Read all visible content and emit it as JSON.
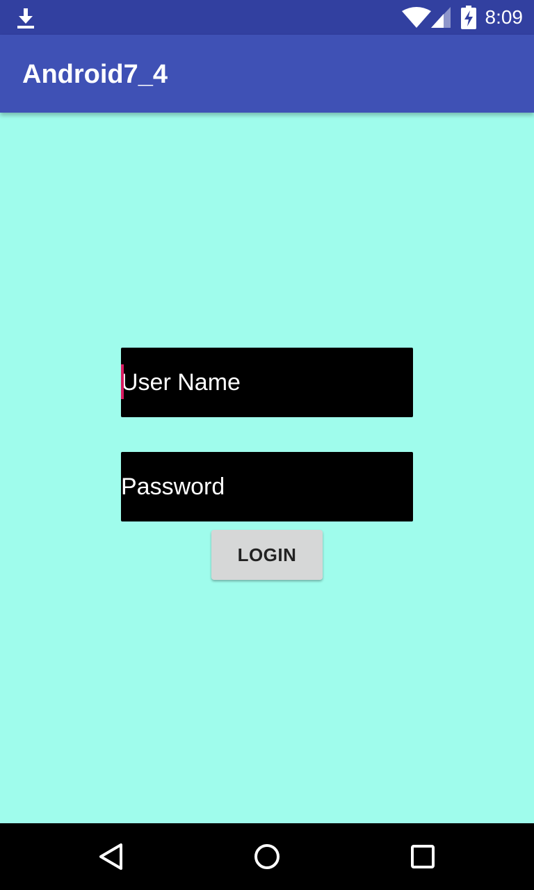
{
  "status_bar": {
    "time": "8:09",
    "icons": [
      "download-icon",
      "wifi-icon",
      "signal-icon",
      "battery-charging-icon"
    ],
    "background": "#3240a0"
  },
  "app_bar": {
    "title": "Android7_4",
    "background": "#3f51b5"
  },
  "login_form": {
    "username_placeholder": "User Name",
    "password_placeholder": "Password",
    "login_label": "LOGIN"
  },
  "nav_bar": {
    "icons": [
      "back-icon",
      "home-icon",
      "recents-icon"
    ]
  },
  "colors": {
    "screen_background": "#9ffcec",
    "field_background": "#000000",
    "cursor": "#d81b60",
    "button_background": "#d6d7d7"
  }
}
